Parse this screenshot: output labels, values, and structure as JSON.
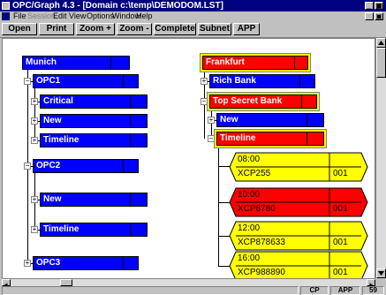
{
  "window": {
    "title": "OPC/Graph 4.3 - [Domain c:\\temp\\DEMODOM.LST]",
    "minimize_symbol": "_",
    "restore_symbol": "▣"
  },
  "menu": {
    "items": [
      "File",
      "Session",
      "Edit",
      "View",
      "Options",
      "Window",
      "Help"
    ]
  },
  "toolbar": {
    "buttons": [
      "Open",
      "Print",
      "Zoom +",
      "Zoom -",
      "Complete",
      "Subnet",
      "APP"
    ]
  },
  "tree_left": {
    "root": "Munich",
    "opc1": "OPC1",
    "critical": "Critical",
    "new1": "New",
    "timeline1": "Timeline",
    "opc2": "OPC2",
    "new2": "New",
    "timeline2": "Timeline",
    "opc3": "OPC3"
  },
  "tree_right": {
    "root": "Frankfurt",
    "rich_bank": "Rich Bank",
    "top_secret_bank": "Top Secret Bank",
    "new": "New",
    "timeline": "Timeline"
  },
  "expander": {
    "plus": "+",
    "minus": "−"
  },
  "colors": {
    "node_blue": "#0000ff",
    "node_red": "#ff0000",
    "card_yellow": "#ffff00",
    "card_red": "#ff0000",
    "highlight": "#ffff00"
  },
  "timeline_cards": [
    {
      "time": "08:00",
      "code": "XCP255",
      "num": "001",
      "color": "yellow"
    },
    {
      "time": "10:00",
      "code": "XCP8780",
      "num": "001",
      "color": "red"
    },
    {
      "time": "12:00",
      "code": "XCP878633",
      "num": "001",
      "color": "yellow"
    },
    {
      "time": "16:00",
      "code": "XCP988890",
      "num": "001",
      "color": "yellow"
    }
  ],
  "status": {
    "cells": [
      "CP",
      "APP",
      "59"
    ]
  }
}
